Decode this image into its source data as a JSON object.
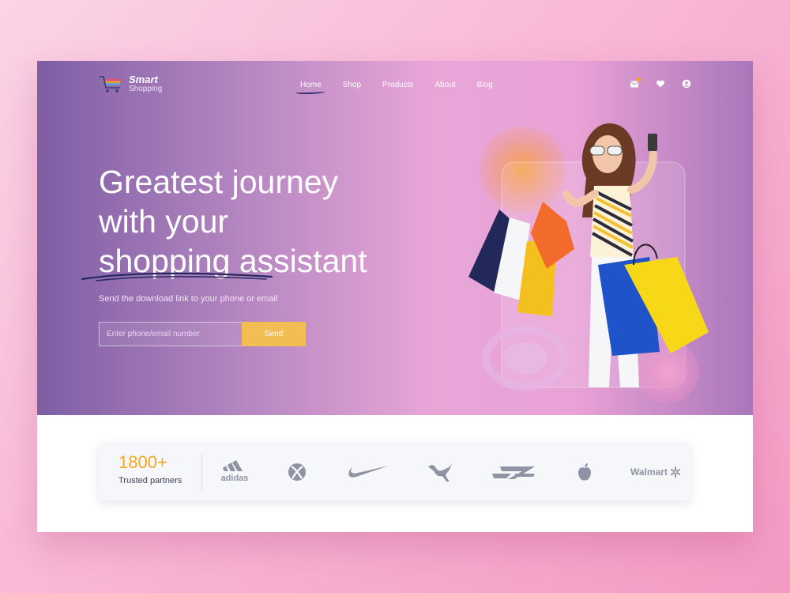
{
  "brand": {
    "title": "Smart",
    "subtitle": "Shopping"
  },
  "nav": {
    "items": [
      {
        "label": "Home",
        "active": true
      },
      {
        "label": "Shop",
        "active": false
      },
      {
        "label": "Products",
        "active": false
      },
      {
        "label": "About",
        "active": false
      },
      {
        "label": "Blog",
        "active": false
      }
    ]
  },
  "header_icons": [
    "notification-icon",
    "heart-icon",
    "user-icon"
  ],
  "hero": {
    "headline_lines": [
      "Greatest journey",
      "with your",
      "shopping assistant"
    ],
    "subtitle": "Send the download link to your phone or email",
    "input_placeholder": "Enter phone/email number",
    "send_label": "Send"
  },
  "partners": {
    "count": "1800+",
    "label": "Trusted partners",
    "logos": [
      "adidas-logo",
      "xbox-logo",
      "nike-logo",
      "puma-logo",
      "reebok-logo",
      "apple-logo",
      "walmart-logo"
    ],
    "logo_texts": {
      "adidas": "adidas",
      "walmart": "Walmart"
    }
  },
  "colors": {
    "accent": "#f2bd52",
    "count": "#f5a623",
    "hero_left": "#7e5ea4",
    "hero_mid": "#e8a6d7",
    "logo_gray": "#8f93a4"
  }
}
